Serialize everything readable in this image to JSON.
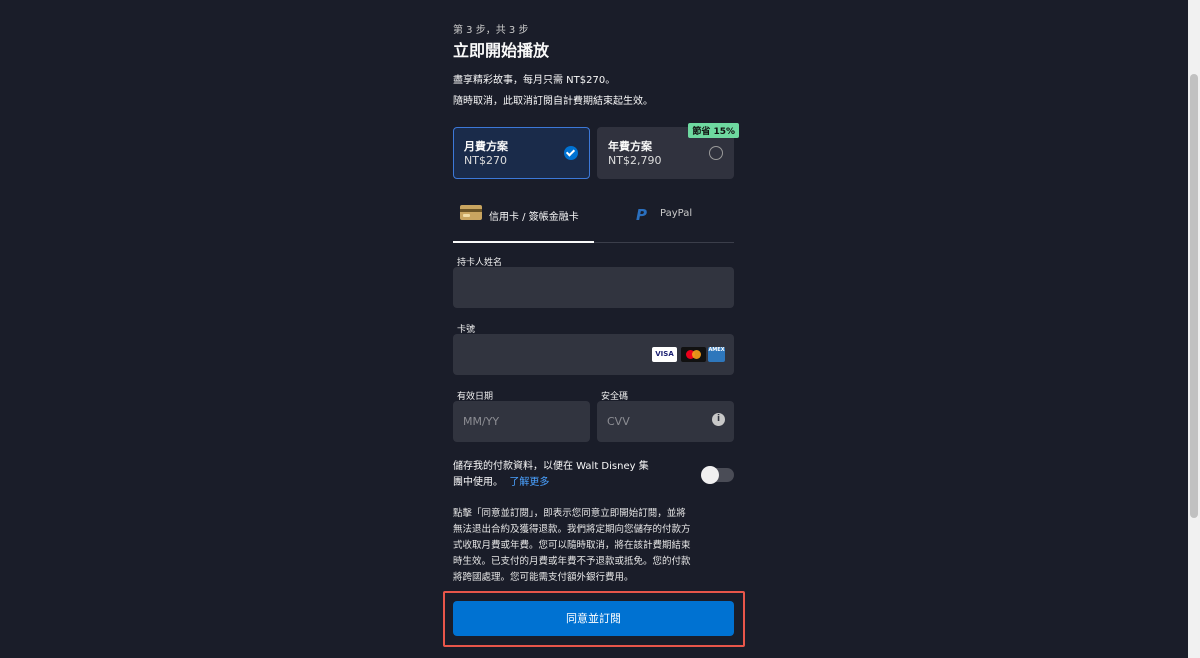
{
  "header": {
    "step": "第 3 步，共 3 步",
    "title": "立即開始播放"
  },
  "intro": {
    "line1": "盡享精彩故事，每月只需 NT$270。",
    "line2": "隨時取消，此取消訂閱自計費期結束起生效。"
  },
  "plans": {
    "monthly": {
      "name": "月費方案",
      "price": "NT$270",
      "selected": true
    },
    "annual": {
      "name": "年費方案",
      "price": "NT$2,790",
      "badge": "節省 15%",
      "selected": false
    }
  },
  "payment_tabs": {
    "card": "信用卡 / 簽帳金融卡",
    "paypal": "PayPal",
    "active": "card"
  },
  "form": {
    "cardholder_label": "持卡人姓名",
    "cardholder_value": "",
    "card_number_label": "卡號",
    "card_number_value": "",
    "card_brands": [
      "VISA",
      "Mastercard",
      "AMEX"
    ],
    "expiry_label": "有效日期",
    "expiry_placeholder": "MM/YY",
    "cvv_label": "安全碼",
    "cvv_placeholder": "CVV"
  },
  "save_payment": {
    "line1": "儲存我的付款資料，以便在 Walt Disney 集",
    "line2": "團中使用。",
    "learn_more": "了解更多",
    "enabled": false
  },
  "legal": [
    "點擊「同意並訂閱」，即表示您同意立即開始訂閱，並將",
    "無法退出合約及獲得退款。我們將定期向您儲存的付款方",
    "式收取月費或年費。您可以隨時取消，將在該計費期結束",
    "時生效。已支付的月費或年費不予退款或抵免。您的付款",
    "將跨國處理。您可能需支付額外銀行費用。"
  ],
  "subscribe_label": "同意並訂閱",
  "colors": {
    "background": "#1a1d29",
    "accent": "#0072d2",
    "badge": "#6ed9a0",
    "highlight": "#e8564a"
  }
}
